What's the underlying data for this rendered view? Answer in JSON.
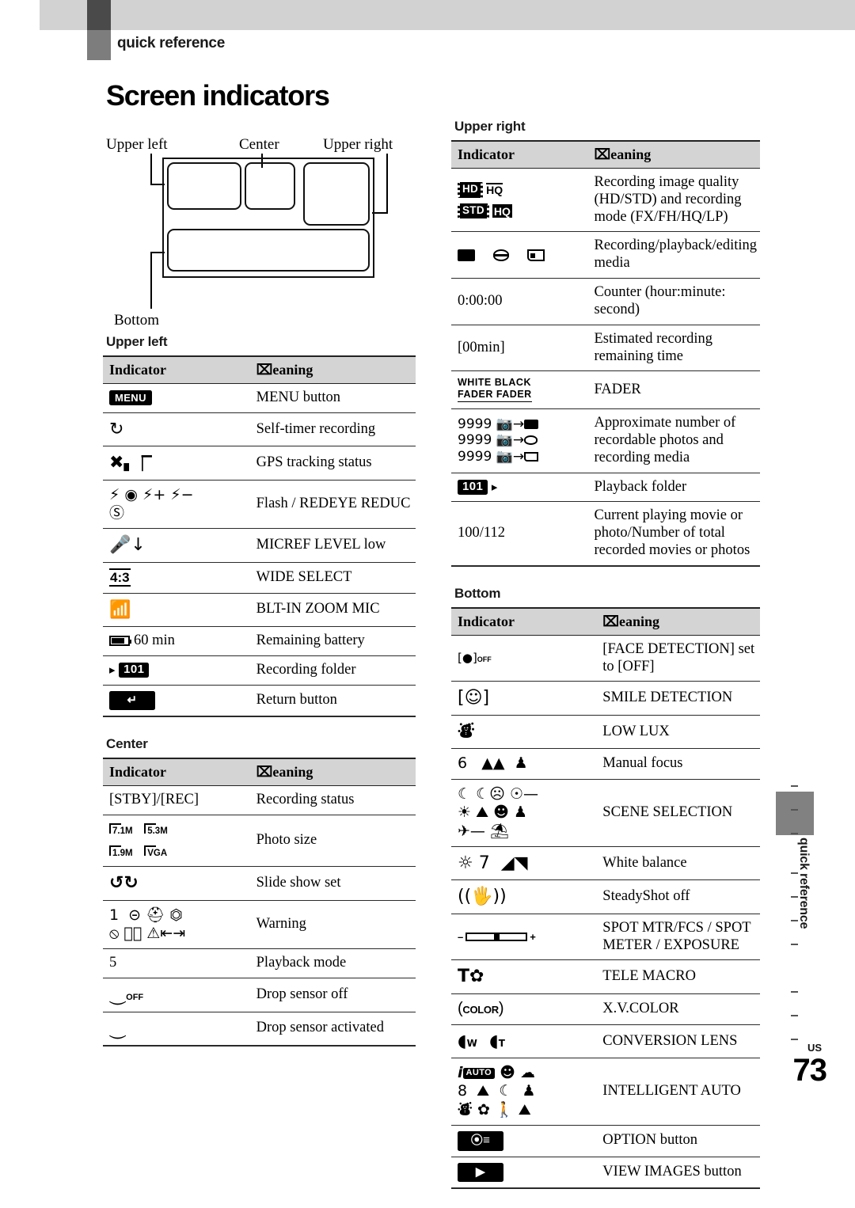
{
  "header": {
    "kicker": "quick reference",
    "title": "Screen indicators"
  },
  "diagram": {
    "labels": {
      "upper_left": "Upper left",
      "center": "Center",
      "upper_right": "Upper right",
      "bottom": "Bottom"
    }
  },
  "table_headers": {
    "indicator": "Indicator",
    "meaning": "⌧eaning"
  },
  "sections": {
    "upper_left": {
      "caption": "Upper left",
      "rows": [
        {
          "icons": [
            {
              "type": "badge",
              "text": "MENU"
            }
          ],
          "meaning": "MENU button"
        },
        {
          "icons": [
            {
              "type": "glyph",
              "text": "↻"
            }
          ],
          "meaning": "Self-timer recording"
        },
        {
          "icons": [
            {
              "type": "glyph",
              "text": "✘‖"
            }
          ],
          "meaning": "GPS tracking status"
        },
        {
          "icons": [
            {
              "type": "glyph",
              "text": "⚡ ◉ ⚡+ ⚡−"
            },
            {
              "type": "glyph",
              "text": "ⓘ"
            }
          ],
          "meaning": "Flash / REDEYE REDUC"
        },
        {
          "icons": [
            {
              "type": "glyph",
              "text": "↑↓"
            }
          ],
          "meaning": "MICREF LEVEL low"
        },
        {
          "icons": [
            {
              "type": "ratio",
              "text": "4:3"
            }
          ],
          "meaning": "WIDE SELECT"
        },
        {
          "icons": [
            {
              "type": "glyph",
              "text": "◑"
            }
          ],
          "meaning": "BLT-IN ZOOM MIC"
        },
        {
          "icons": [
            {
              "type": "battery",
              "text": "60 min"
            }
          ],
          "meaning": "Remaining battery"
        },
        {
          "icons": [
            {
              "type": "folder",
              "text": "101",
              "arrow": "left"
            }
          ],
          "meaning": "Recording folder"
        },
        {
          "icons": [
            {
              "type": "badge-wide",
              "text": "↶"
            }
          ],
          "meaning": "Return button"
        }
      ]
    },
    "center": {
      "caption": "Center",
      "rows": [
        {
          "icons": [
            {
              "type": "text",
              "text": "[STBY]/[REC]"
            }
          ],
          "meaning": "Recording status"
        },
        {
          "icons": [
            {
              "type": "photosize",
              "values": [
                "7.1M",
                "5.3M",
                "1.9M",
                "VGA"
              ]
            }
          ],
          "meaning": "Photo size"
        },
        {
          "icons": [
            {
              "type": "glyph",
              "text": "↺↻"
            }
          ],
          "meaning": "Slide show set"
        },
        {
          "icons": [
            {
              "type": "warning",
              "line1": "1  ⊘ ⌧ ◸",
              "line2": "⦸ ⊘ ⚠↕"
            }
          ],
          "meaning": "Warning"
        },
        {
          "icons": [
            {
              "type": "text",
              "text": "5"
            }
          ],
          "meaning": "Playback mode"
        },
        {
          "icons": [
            {
              "type": "glyph",
              "text": "⌽ₒғғ"
            }
          ],
          "meaning": "Drop sensor off"
        },
        {
          "icons": [
            {
              "type": "glyph",
              "text": "⌽"
            }
          ],
          "meaning": "Drop sensor activated"
        }
      ]
    },
    "upper_right": {
      "caption": "Upper right",
      "rows": [
        {
          "icons": [
            {
              "type": "quality",
              "line1": [
                "HD",
                "HQ"
              ],
              "line2": [
                "STD",
                "HQ"
              ]
            }
          ],
          "meaning": "Recording image quality (HD/STD) and recording mode (FX/FH/HQ/LP)"
        },
        {
          "icons": [
            {
              "type": "glyph",
              "text": "▤ ⛃ ⏴"
            }
          ],
          "meaning": "Recording/playback/editing media"
        },
        {
          "icons": [
            {
              "type": "text",
              "text": "0:00:00"
            }
          ],
          "meaning": "Counter (hour:minute: second)"
        },
        {
          "icons": [
            {
              "type": "text",
              "text": "[00min]"
            }
          ],
          "meaning": "Estimated recording remaining time"
        },
        {
          "icons": [
            {
              "type": "fader",
              "line1": "WHITE BLACK",
              "line2": "FADER FADER"
            }
          ],
          "meaning": "FADER"
        },
        {
          "icons": [
            {
              "type": "photocount",
              "lines": [
                "9999 ⬛→▤",
                "9999 ⬛→⛃",
                "9999 ⬛→⏴"
              ]
            }
          ],
          "meaning": "Approximate number of recordable photos and recording media"
        },
        {
          "icons": [
            {
              "type": "folder",
              "text": "101",
              "arrow": "right"
            }
          ],
          "meaning": "Playback folder"
        },
        {
          "icons": [
            {
              "type": "text",
              "text": "100/112"
            }
          ],
          "meaning": "Current playing movie or photo/Number of total recorded movies or photos"
        }
      ]
    },
    "bottom": {
      "caption": "Bottom",
      "rows": [
        {
          "icons": [
            {
              "type": "glyph",
              "text": "[☉]ₒғғ"
            }
          ],
          "meaning": "[FACE DETECTION] set to [OFF]"
        },
        {
          "icons": [
            {
              "type": "glyph",
              "text": "[☺]"
            }
          ],
          "meaning": "SMILE DETECTION"
        },
        {
          "icons": [
            {
              "type": "glyph",
              "text": "♟"
            }
          ],
          "meaning": "LOW LUX"
        },
        {
          "icons": [
            {
              "type": "glyph",
              "text": "6   ⛰ ⚬"
            }
          ],
          "meaning": "Manual focus"
        },
        {
          "icons": [
            {
              "type": "scene",
              "line1": "☾ ☾☹ ☉—",
              "line2": "☀ ⛰ ☻ ♟",
              "line3": "✈— ⛱"
            }
          ],
          "meaning": "SCENE SELECTION"
        },
        {
          "icons": [
            {
              "type": "glyph",
              "text": "☀ 7   ◤◢"
            }
          ],
          "meaning": "White balance"
        },
        {
          "icons": [
            {
              "type": "glyph",
              "text": "((✋))"
            }
          ],
          "meaning": "SteadyShot off"
        },
        {
          "icons": [
            {
              "type": "slider",
              "text": "– +"
            }
          ],
          "meaning": "SPOT MTR/FCS / SPOT METER / EXPOSURE"
        },
        {
          "icons": [
            {
              "type": "glyph",
              "text": "T⚘"
            }
          ],
          "meaning": "TELE MACRO"
        },
        {
          "icons": [
            {
              "type": "xvcolor",
              "text": "COLOR"
            }
          ],
          "meaning": "X.V.COLOR"
        },
        {
          "icons": [
            {
              "type": "glyph",
              "text": "◗w ◗ᴛ"
            }
          ],
          "meaning": "CONVERSION LENS"
        },
        {
          "icons": [
            {
              "type": "iauto",
              "line1": "i AUTO ☻ ☾",
              "line2": "8  ⛰ ☾ ♟",
              "line3": "♟ ⚘ ♟ ⚘"
            }
          ],
          "meaning": "INTELLIGENT AUTO"
        },
        {
          "icons": [
            {
              "type": "badge-wide",
              "text": "⊕≡"
            }
          ],
          "meaning": "OPTION button"
        },
        {
          "icons": [
            {
              "type": "badge-wide",
              "text": "▶"
            }
          ],
          "meaning": "VIEW IMAGES button"
        }
      ]
    }
  },
  "side_tab": {
    "label": "quick reference"
  },
  "folio": {
    "region": "US",
    "page": "73"
  }
}
